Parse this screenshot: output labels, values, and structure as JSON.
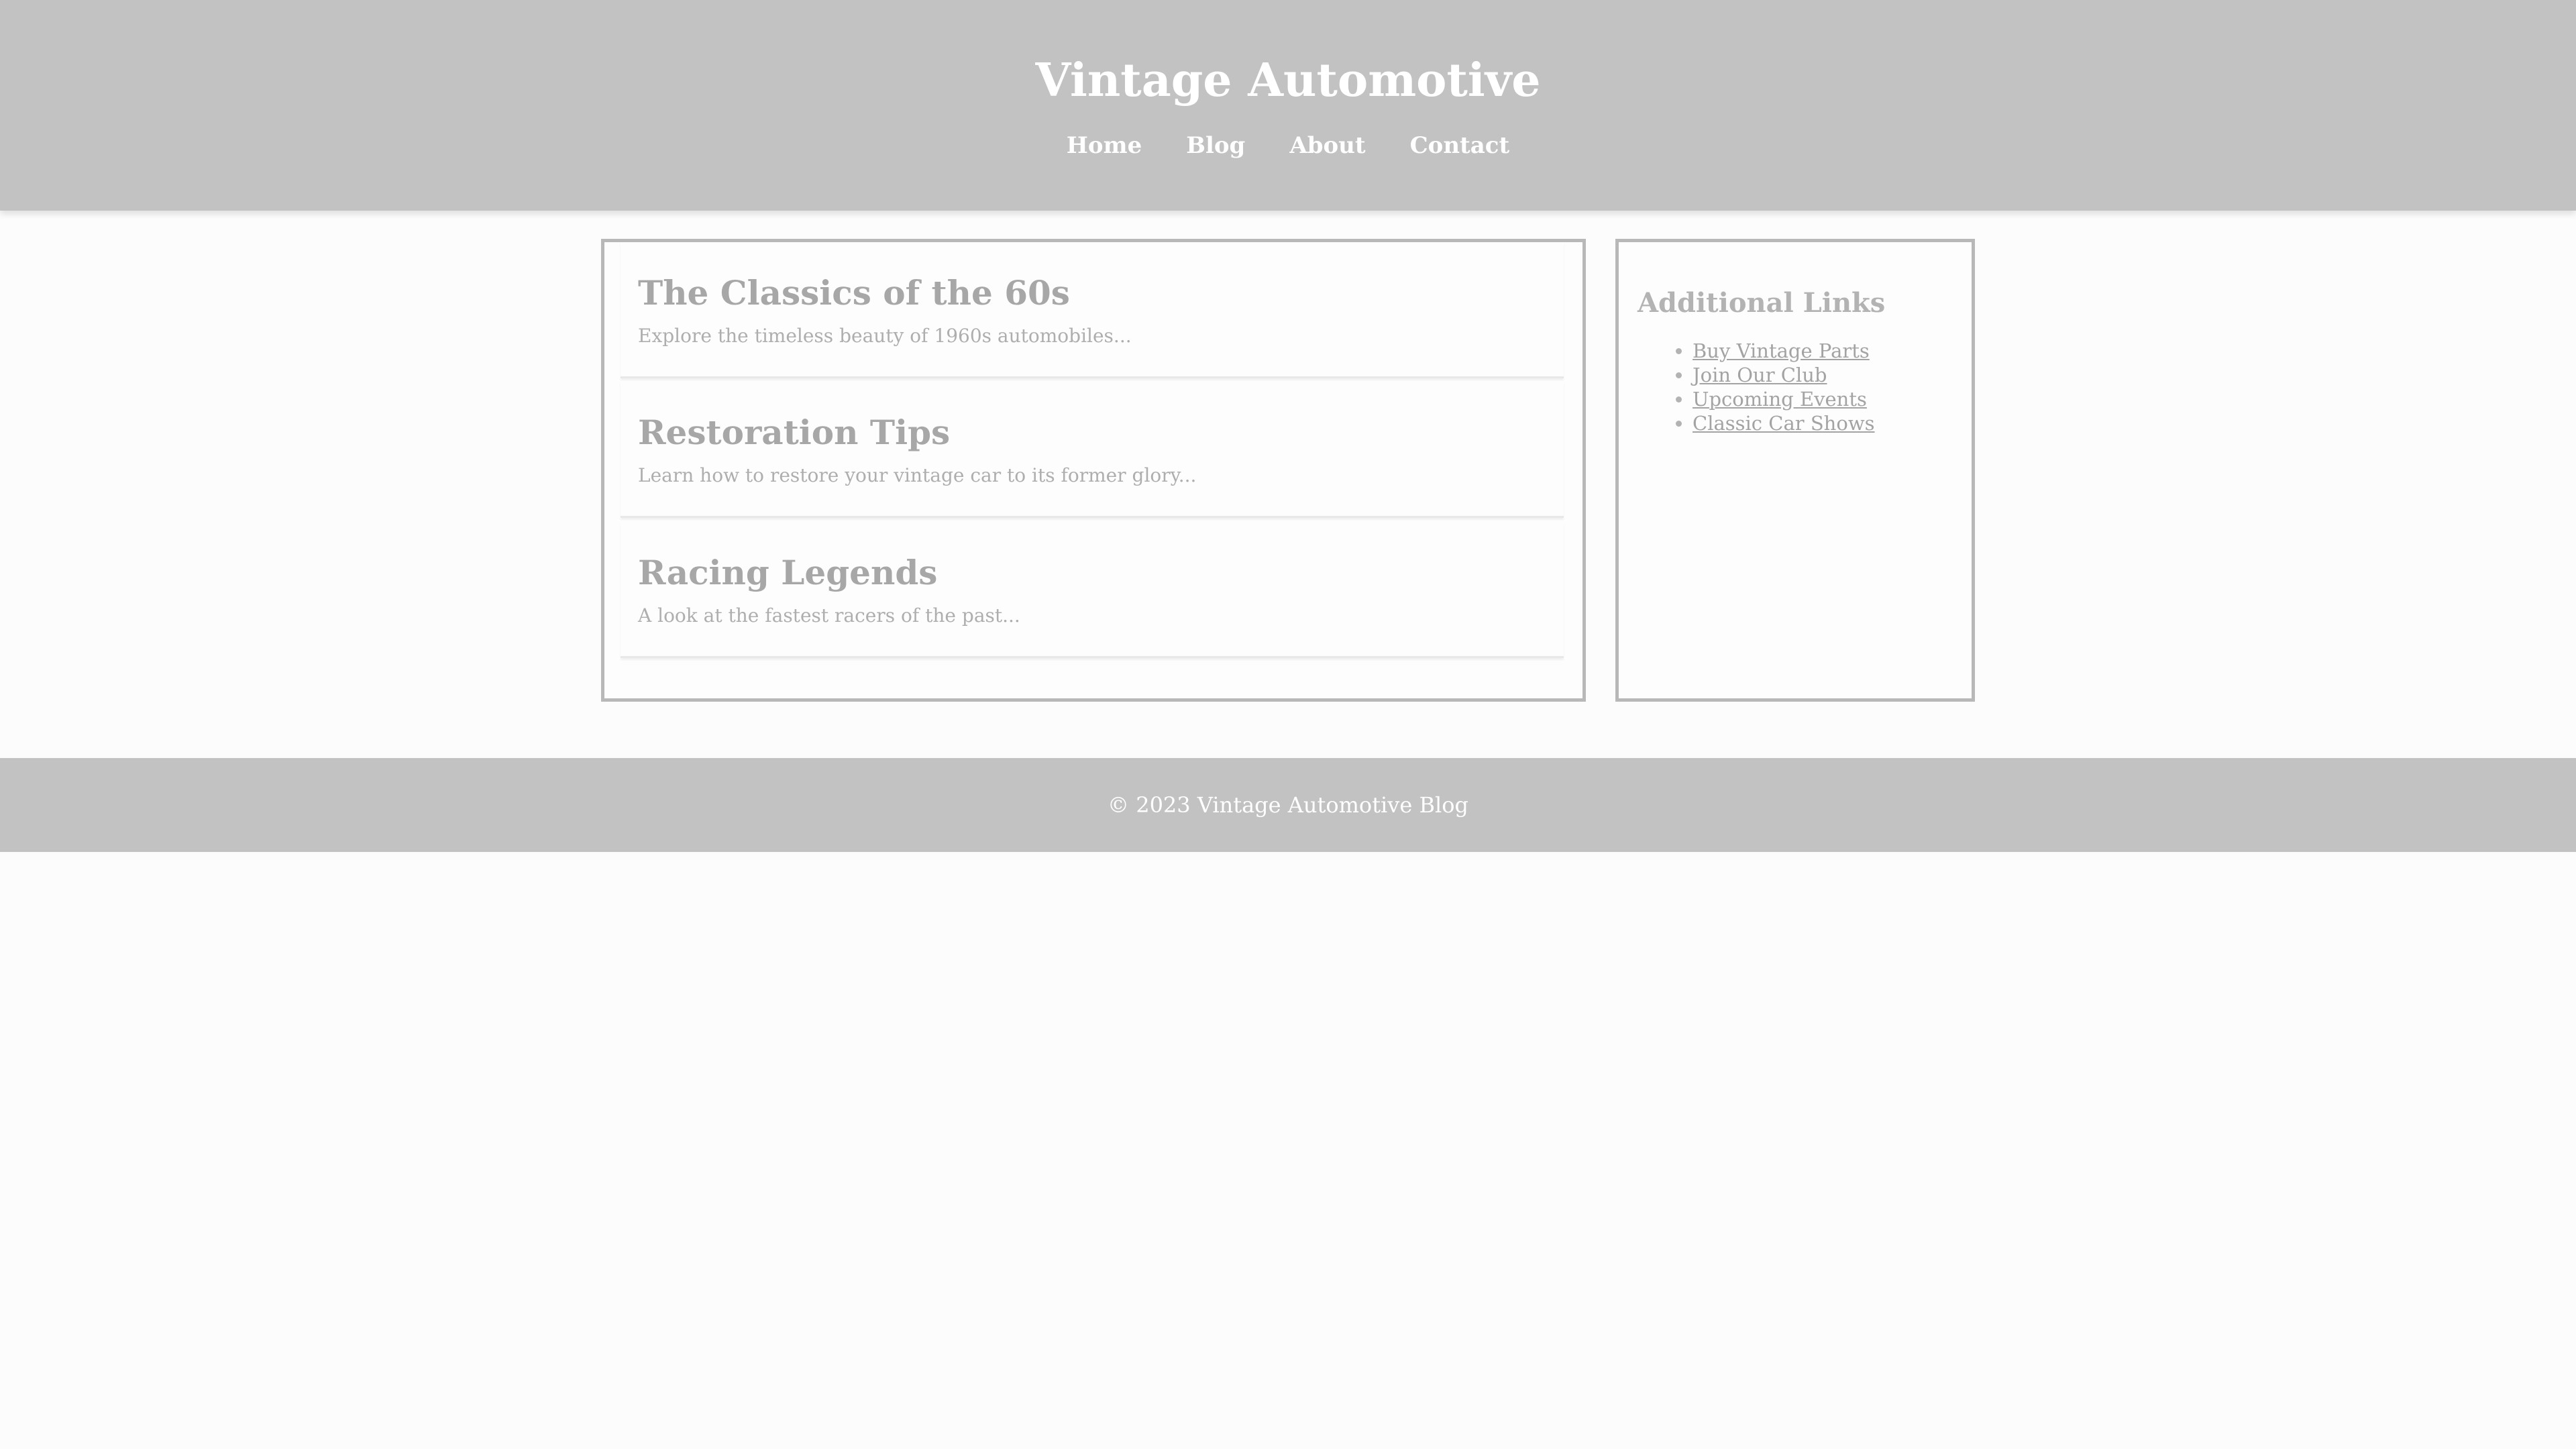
{
  "header": {
    "title": "Vintage Automotive",
    "nav": [
      "Home",
      "Blog",
      "About",
      "Contact"
    ]
  },
  "posts": [
    {
      "title": "The Classics of the 60s",
      "excerpt": "Explore the timeless beauty of 1960s automobiles..."
    },
    {
      "title": "Restoration Tips",
      "excerpt": "Learn how to restore your vintage car to its former glory..."
    },
    {
      "title": "Racing Legends",
      "excerpt": "A look at the fastest racers of the past..."
    }
  ],
  "sidebar": {
    "title": "Additional Links",
    "links": [
      "Buy Vintage Parts",
      "Join Our Club",
      "Upcoming Events",
      "Classic Car Shows"
    ]
  },
  "footer": {
    "text": "© 2023 Vintage Automotive Blog"
  },
  "colors": {
    "header_background": "#c2c2c2",
    "page_background": "#fcfcfc",
    "heading_text": "#a7a7a7"
  }
}
